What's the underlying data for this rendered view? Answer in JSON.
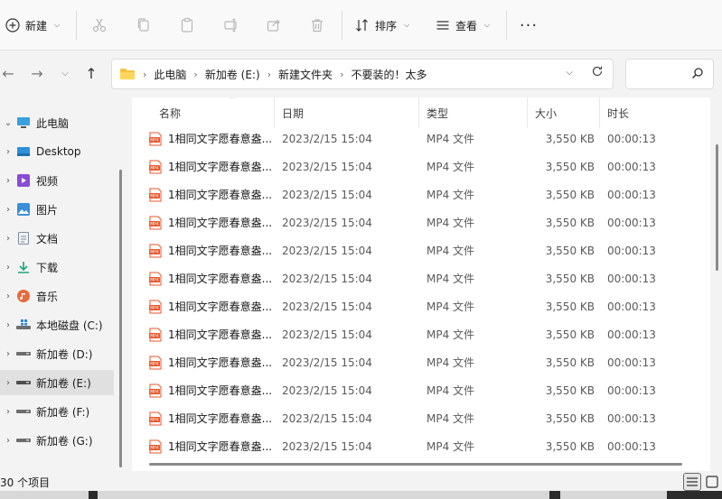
{
  "toolbar": {
    "new_label": "新建",
    "sort_label": "排序",
    "view_label": "查看",
    "icons": [
      "cut-icon",
      "copy-icon",
      "paste-icon",
      "rename-icon",
      "share-icon",
      "delete-icon"
    ]
  },
  "address": {
    "crumbs": [
      "此电脑",
      "新加卷 (E:)",
      "新建文件夹",
      "不要装的！太多"
    ]
  },
  "sidebar": {
    "items": [
      {
        "label": "此电脑",
        "icon": "computer-icon",
        "expanded": true
      },
      {
        "label": "Desktop",
        "icon": "desktop-icon"
      },
      {
        "label": "视频",
        "icon": "video-icon"
      },
      {
        "label": "图片",
        "icon": "pictures-icon"
      },
      {
        "label": "文档",
        "icon": "documents-icon"
      },
      {
        "label": "下载",
        "icon": "download-icon"
      },
      {
        "label": "音乐",
        "icon": "music-icon"
      },
      {
        "label": "本地磁盘 (C:)",
        "icon": "windows-drive-icon"
      },
      {
        "label": "新加卷 (D:)",
        "icon": "drive-icon"
      },
      {
        "label": "新加卷 (E:)",
        "icon": "drive-icon",
        "selected": true
      },
      {
        "label": "新加卷 (F:)",
        "icon": "drive-icon"
      },
      {
        "label": "新加卷 (G:)",
        "icon": "drive-icon"
      }
    ]
  },
  "columns": {
    "name": "名称",
    "date": "日期",
    "type": "类型",
    "size": "大小",
    "duration": "时长"
  },
  "files": [
    {
      "name": "1相同文字愿春意盎...",
      "date": "2023/2/15 15:04",
      "type": "MP4 文件",
      "size": "3,550 KB",
      "duration": "00:00:13"
    },
    {
      "name": "1相同文字愿春意盎...",
      "date": "2023/2/15 15:04",
      "type": "MP4 文件",
      "size": "3,550 KB",
      "duration": "00:00:13"
    },
    {
      "name": "1相同文字愿春意盎...",
      "date": "2023/2/15 15:04",
      "type": "MP4 文件",
      "size": "3,550 KB",
      "duration": "00:00:13"
    },
    {
      "name": "1相同文字愿春意盎...",
      "date": "2023/2/15 15:04",
      "type": "MP4 文件",
      "size": "3,550 KB",
      "duration": "00:00:13"
    },
    {
      "name": "1相同文字愿春意盎...",
      "date": "2023/2/15 15:04",
      "type": "MP4 文件",
      "size": "3,550 KB",
      "duration": "00:00:13"
    },
    {
      "name": "1相同文字愿春意盎...",
      "date": "2023/2/15 15:04",
      "type": "MP4 文件",
      "size": "3,550 KB",
      "duration": "00:00:13"
    },
    {
      "name": "1相同文字愿春意盎...",
      "date": "2023/2/15 15:04",
      "type": "MP4 文件",
      "size": "3,550 KB",
      "duration": "00:00:13"
    },
    {
      "name": "1相同文字愿春意盎...",
      "date": "2023/2/15 15:04",
      "type": "MP4 文件",
      "size": "3,550 KB",
      "duration": "00:00:13"
    },
    {
      "name": "1相同文字愿春意盎...",
      "date": "2023/2/15 15:04",
      "type": "MP4 文件",
      "size": "3,550 KB",
      "duration": "00:00:13"
    },
    {
      "name": "1相同文字愿春意盎...",
      "date": "2023/2/15 15:04",
      "type": "MP4 文件",
      "size": "3,550 KB",
      "duration": "00:00:13"
    },
    {
      "name": "1相同文字愿春意盎...",
      "date": "2023/2/15 15:04",
      "type": "MP4 文件",
      "size": "3,550 KB",
      "duration": "00:00:13"
    },
    {
      "name": "1相同文字愿春意盎...",
      "date": "2023/2/15 15:04",
      "type": "MP4 文件",
      "size": "3,550 KB",
      "duration": "00:00:13"
    }
  ],
  "status": {
    "item_count": "30 个项目"
  },
  "colors": {
    "accent": "#0067c0",
    "file_icon": "#e8562a",
    "selected_bg": "#e0e0e0"
  }
}
